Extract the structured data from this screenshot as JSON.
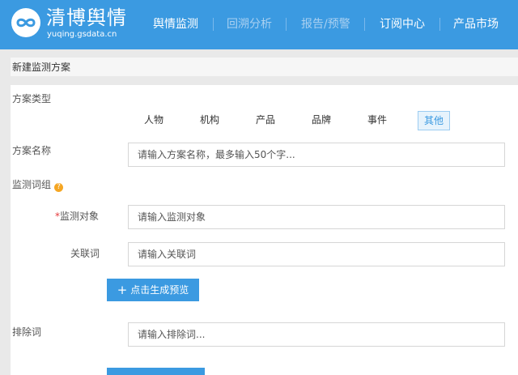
{
  "header": {
    "brand_name": "清博舆情",
    "brand_domain": "yuqing.gsdata.cn",
    "logo_icon": "infinity-logo-icon",
    "nav": [
      {
        "label": "舆情监测",
        "state": "active"
      },
      {
        "label": "回溯分析",
        "state": "disabled"
      },
      {
        "label": "报告/预警",
        "state": "disabled"
      },
      {
        "label": "订阅中心",
        "state": "normal"
      },
      {
        "label": "产品市场",
        "state": "normal"
      }
    ]
  },
  "form": {
    "title": "新建监测方案",
    "plan_type": {
      "label": "方案类型",
      "options": [
        "人物",
        "机构",
        "产品",
        "品牌",
        "事件",
        "其他"
      ],
      "selected": "其他"
    },
    "plan_name": {
      "label": "方案名称",
      "placeholder": "请输入方案名称，最多输入50个字...",
      "value": ""
    },
    "keyword_group": {
      "label": "监测词组",
      "help_icon": "question-circle-icon",
      "help_glyph": "?"
    },
    "monitor_target": {
      "required_mark": "*",
      "label": "监测对象",
      "placeholder": "请输入监测对象",
      "value": ""
    },
    "related_words": {
      "label": "关联词",
      "placeholder": "请输入关联词",
      "value": ""
    },
    "preview_button": {
      "icon": "plus-icon",
      "icon_glyph": "+",
      "label": "点击生成预览"
    },
    "exclude_words": {
      "label": "排除词",
      "placeholder": "请输入排除词...",
      "value": ""
    }
  },
  "colors": {
    "primary": "#3b9ae1",
    "background": "#e9e9e9",
    "required": "#e4393c",
    "help": "#f5a623"
  }
}
